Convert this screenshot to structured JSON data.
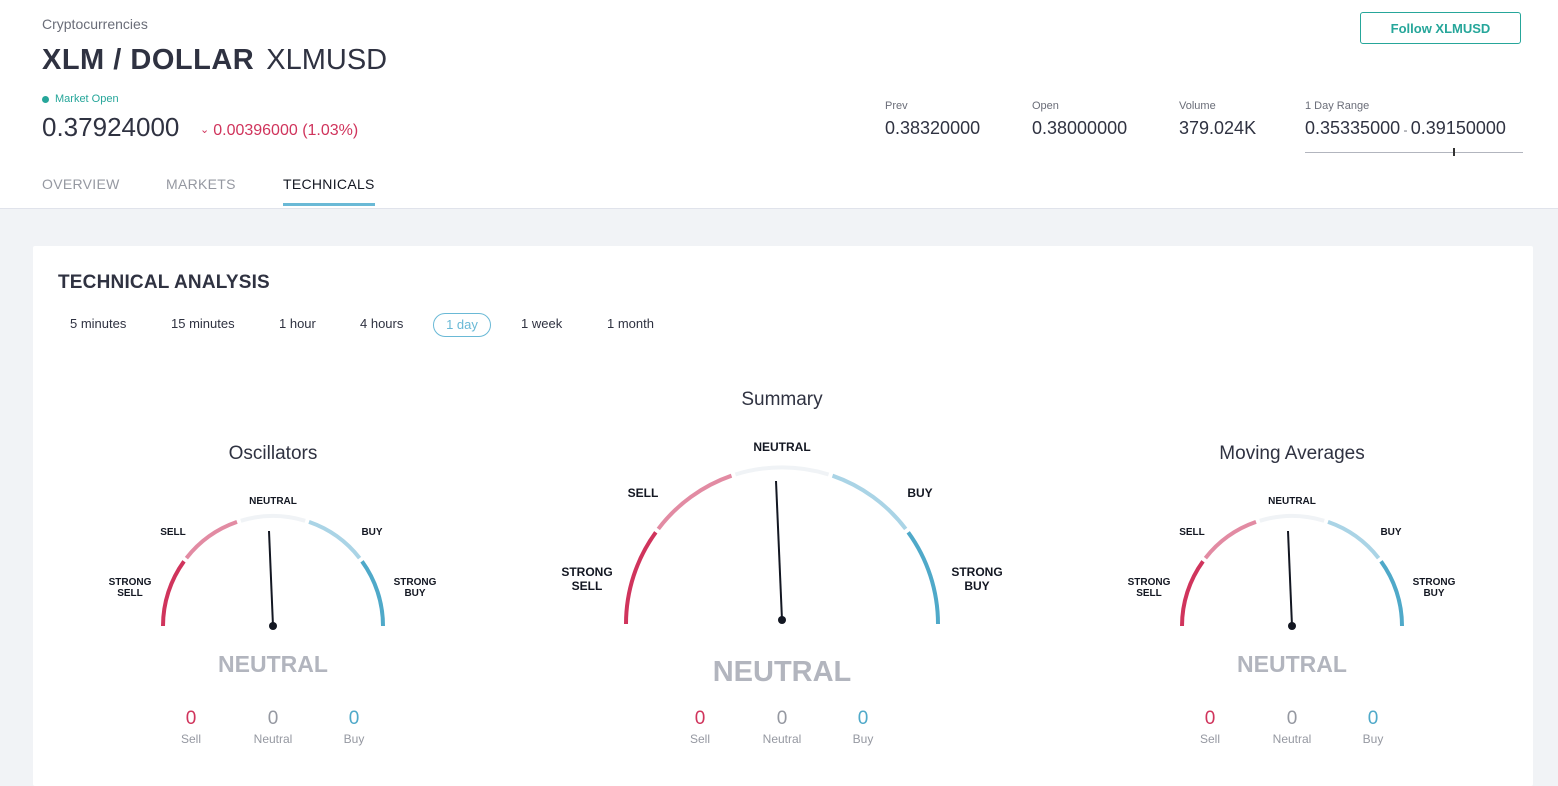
{
  "header": {
    "category": "Cryptocurrencies",
    "pair": "XLM / DOLLAR",
    "ticker": "XLMUSD",
    "market_status": "Market Open",
    "price": "0.37924000",
    "change": "0.00396000 (1.03%)",
    "follow_label": "Follow XLMUSD",
    "stats": {
      "prev": {
        "label": "Prev",
        "value": "0.38320000"
      },
      "open": {
        "label": "Open",
        "value": "0.38000000"
      },
      "volume": {
        "label": "Volume",
        "value": "379.024K"
      },
      "range": {
        "label": "1 Day Range",
        "low": "0.35335000",
        "high": "0.39150000"
      }
    },
    "tabs": [
      "OVERVIEW",
      "MARKETS",
      "TECHNICALS"
    ],
    "active_tab": "TECHNICALS"
  },
  "technical": {
    "title": "TECHNICAL ANALYSIS",
    "intervals": [
      "5 minutes",
      "15 minutes",
      "1 hour",
      "4 hours",
      "1 day",
      "1 week",
      "1 month"
    ],
    "active_interval": "1 day",
    "gauge_labels": {
      "strong_sell_1": "STRONG",
      "strong_sell_2": "SELL",
      "sell": "SELL",
      "neutral": "NEUTRAL",
      "buy": "BUY",
      "strong_buy_1": "STRONG",
      "strong_buy_2": "BUY"
    },
    "count_labels": {
      "sell": "Sell",
      "neutral": "Neutral",
      "buy": "Buy"
    },
    "oscillators": {
      "title": "Oscillators",
      "verdict": "NEUTRAL",
      "sell": "0",
      "neutral": "0",
      "buy": "0"
    },
    "summary": {
      "title": "Summary",
      "verdict": "NEUTRAL",
      "sell": "0",
      "neutral": "0",
      "buy": "0"
    },
    "moving_averages": {
      "title": "Moving Averages",
      "verdict": "NEUTRAL",
      "sell": "0",
      "neutral": "0",
      "buy": "0"
    }
  },
  "colors": {
    "sell": "#d0345c",
    "sell_light": "#e28ba3",
    "neutral_arc": "#f0f3f6",
    "buy_light": "#aad4e6",
    "buy": "#4fa9c9",
    "accent": "#26a69a",
    "tab_underline": "#6ab9d6"
  }
}
